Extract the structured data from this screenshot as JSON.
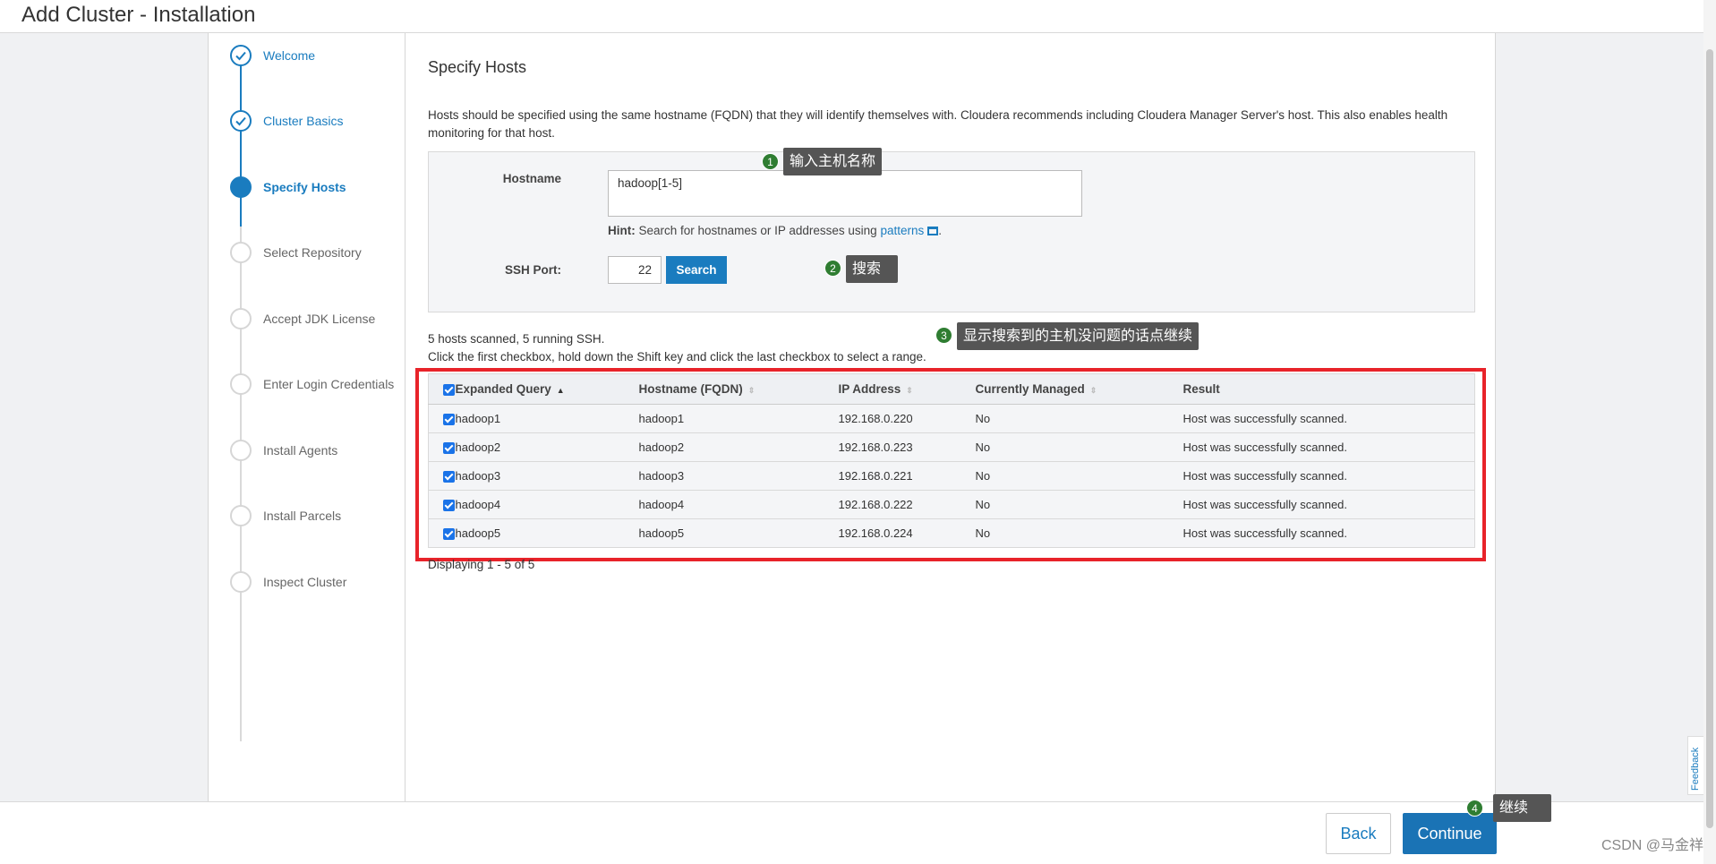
{
  "header": {
    "title": "Add Cluster - Installation"
  },
  "steps": [
    {
      "label": "Welcome",
      "state": "done"
    },
    {
      "label": "Cluster Basics",
      "state": "done"
    },
    {
      "label": "Specify Hosts",
      "state": "active"
    },
    {
      "label": "Select Repository",
      "state": "pending"
    },
    {
      "label": "Accept JDK License",
      "state": "pending"
    },
    {
      "label": "Enter Login Credentials",
      "state": "pending"
    },
    {
      "label": "Install Agents",
      "state": "pending"
    },
    {
      "label": "Install Parcels",
      "state": "pending"
    },
    {
      "label": "Inspect Cluster",
      "state": "pending"
    }
  ],
  "main": {
    "title": "Specify Hosts",
    "description": "Hosts should be specified using the same hostname (FQDN) that they will identify themselves with. Cloudera recommends including Cloudera Manager Server's host. This also enables health monitoring for that host.",
    "form": {
      "hostname_label": "Hostname",
      "hostname_value": "hadoop[1-5]",
      "hint_prefix": "Hint:",
      "hint_text": "Search for hostnames or IP addresses using",
      "hint_link": "patterns",
      "hint_suffix": ".",
      "ssh_port_label": "SSH Port:",
      "ssh_port_value": "22",
      "search_label": "Search"
    },
    "status_line1": "5 hosts scanned, 5 running SSH.",
    "status_line2": "Click the first checkbox, hold down the Shift key and click the last checkbox to select a range.",
    "table": {
      "columns": [
        "Expanded Query",
        "Hostname (FQDN)",
        "IP Address",
        "Currently Managed",
        "Result"
      ],
      "rows": [
        {
          "query": "hadoop1",
          "fqdn": "hadoop1",
          "ip": "192.168.0.220",
          "managed": "No",
          "result": "Host was successfully scanned.",
          "checked": true
        },
        {
          "query": "hadoop2",
          "fqdn": "hadoop2",
          "ip": "192.168.0.223",
          "managed": "No",
          "result": "Host was successfully scanned.",
          "checked": true
        },
        {
          "query": "hadoop3",
          "fqdn": "hadoop3",
          "ip": "192.168.0.221",
          "managed": "No",
          "result": "Host was successfully scanned.",
          "checked": true
        },
        {
          "query": "hadoop4",
          "fqdn": "hadoop4",
          "ip": "192.168.0.222",
          "managed": "No",
          "result": "Host was successfully scanned.",
          "checked": true
        },
        {
          "query": "hadoop5",
          "fqdn": "hadoop5",
          "ip": "192.168.0.224",
          "managed": "No",
          "result": "Host was successfully scanned.",
          "checked": true
        }
      ]
    },
    "displaying": "Displaying 1 - 5 of 5"
  },
  "annotations": [
    {
      "num": "1",
      "text": "输入主机名称"
    },
    {
      "num": "2",
      "text": "搜索"
    },
    {
      "num": "3",
      "text": "显示搜索到的主机没问题的话点继续"
    },
    {
      "num": "4",
      "text": "继续"
    }
  ],
  "footer": {
    "back_label": "Back",
    "continue_label": "Continue",
    "watermark": "CSDN @马金祥"
  },
  "feedback_label": "Feedback",
  "colors": {
    "accent": "#1a7cbf",
    "highlight_box": "#e8232a",
    "annotation_badge": "#2f7d32"
  }
}
